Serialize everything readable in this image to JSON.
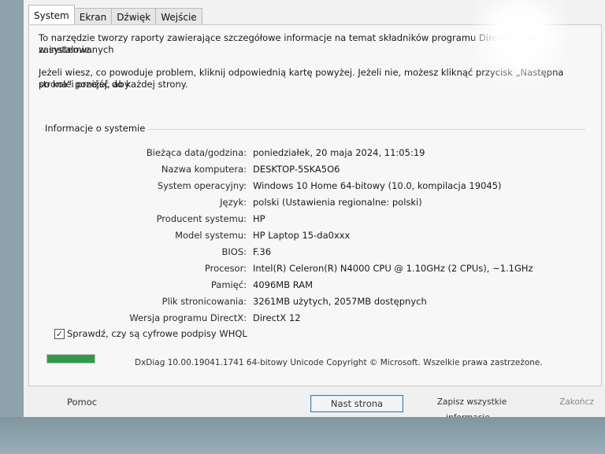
{
  "tabs": [
    {
      "label": "System",
      "active": true
    },
    {
      "label": "Ekran",
      "active": false
    },
    {
      "label": "Dźwięk",
      "active": false
    },
    {
      "label": "Wejście",
      "active": false
    }
  ],
  "intro": {
    "line1": "To narzędzie tworzy raporty zawierające szczegółowe informacje na temat składników programu DirectX i ster... zainstalowanych",
    "line2": "w systemie.",
    "line3": "Jeżeli wiesz, co powoduje problem, kliknij odpowiednią kartę powyżej. Jeżeli nie, możesz kliknąć przycisk „Następna strona” poniżej, aby",
    "line4": "po kolei przejść do każdej strony."
  },
  "group": {
    "title": "Informacje o systemie"
  },
  "system_info": [
    {
      "label": "Bieżąca data/godzina:",
      "value": "poniedziałek, 20 maja 2024, 11:05:19"
    },
    {
      "label": "Nazwa komputera:",
      "value": "DESKTOP-5SKA5O6"
    },
    {
      "label": "System operacyjny:",
      "value": "Windows 10 Home 64-bitowy (10.0, kompilacja 19045)"
    },
    {
      "label": "Język:",
      "value": "polski (Ustawienia regionalne: polski)"
    },
    {
      "label": "Producent systemu:",
      "value": "HP"
    },
    {
      "label": "Model systemu:",
      "value": "HP Laptop 15-da0xxx"
    },
    {
      "label": "BIOS:",
      "value": "F.36"
    },
    {
      "label": "Procesor:",
      "value": "Intel(R) Celeron(R) N4000 CPU @ 1.10GHz (2 CPUs), ~1.1GHz"
    },
    {
      "label": "Pamięć:",
      "value": "4096MB RAM"
    },
    {
      "label": "Plik stronicowania:",
      "value": "3261MB użytych, 2057MB dostępnych"
    },
    {
      "label": "Wersja programu DirectX:",
      "value": "DirectX 12"
    }
  ],
  "whql": {
    "label": "Sprawdź, czy są cyfrowe podpisy WHQL",
    "checked": true,
    "check_glyph": "✓"
  },
  "progress": {
    "fraction": 1.0
  },
  "copyright": "DxDiag 10.00.19041.1741 64-bitowy Unicode  Copyright © Microsoft. Wszelkie prawa zastrzeżone.",
  "buttons": {
    "help": "Pomoc",
    "next": "Nast strona",
    "save": "Zapisz wszystkie informacje...",
    "exit": "Zakończ"
  },
  "colors": {
    "progress_fill": "#2f9a4a",
    "primary_border": "#3c7fb1"
  }
}
